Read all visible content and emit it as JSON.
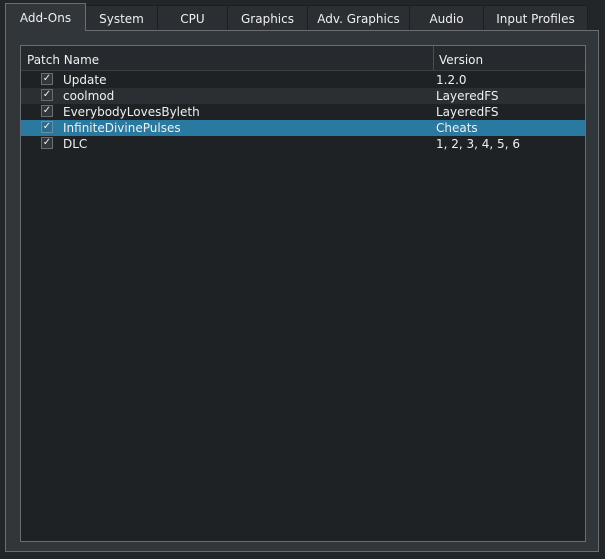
{
  "tabs": [
    {
      "label": "Add-Ons",
      "active": true
    },
    {
      "label": "System",
      "active": false
    },
    {
      "label": "CPU",
      "active": false
    },
    {
      "label": "Graphics",
      "active": false
    },
    {
      "label": "Adv. Graphics",
      "active": false
    },
    {
      "label": "Audio",
      "active": false
    },
    {
      "label": "Input Profiles",
      "active": false
    }
  ],
  "table": {
    "columns": {
      "name": "Patch Name",
      "version": "Version"
    },
    "check_glyph": "✓",
    "rows": [
      {
        "name": "Update",
        "version": "1.2.0",
        "checked": true,
        "selected": false
      },
      {
        "name": "coolmod",
        "version": "LayeredFS",
        "checked": true,
        "selected": false
      },
      {
        "name": "EverybodyLovesByleth",
        "version": "LayeredFS",
        "checked": true,
        "selected": false
      },
      {
        "name": "InfiniteDivinePulses",
        "version": "Cheats",
        "checked": true,
        "selected": true
      },
      {
        "name": "DLC",
        "version": "1, 2, 3, 4, 5, 6",
        "checked": true,
        "selected": false
      }
    ]
  },
  "colors": {
    "background": "#232629",
    "panel": "#31363b",
    "list_background": "#1f2225",
    "selection": "#2a79a0",
    "text": "#eff0f1"
  }
}
